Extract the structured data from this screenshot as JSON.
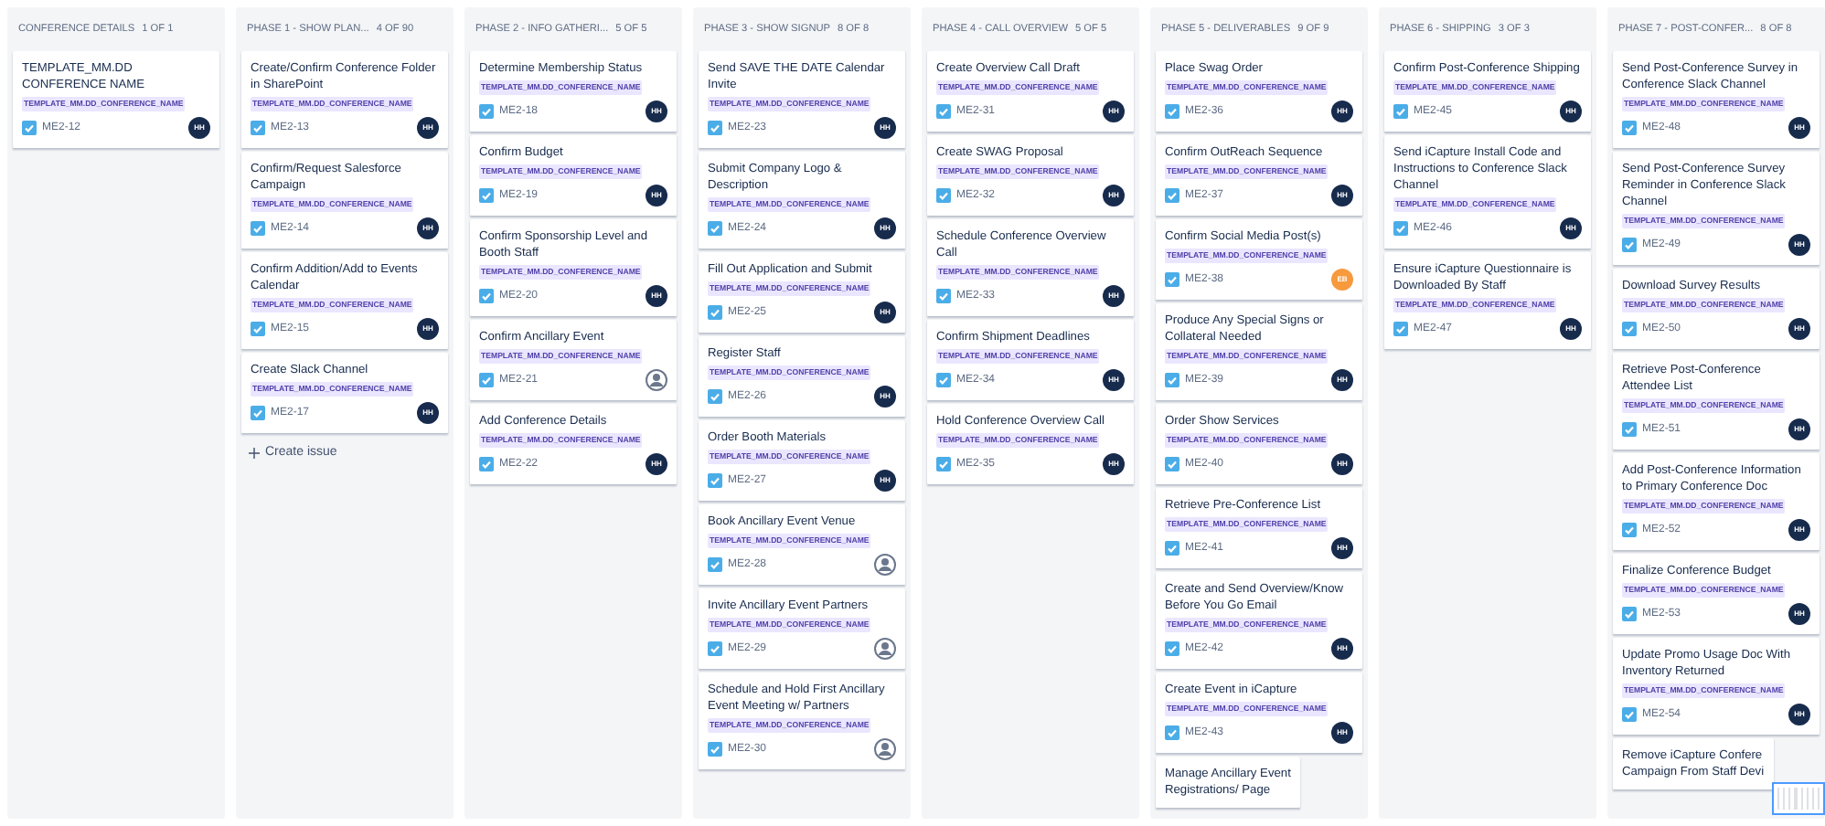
{
  "columns": [
    {
      "name": "CONFERENCE DETAILS",
      "count": "1 OF 1",
      "cards": [
        {
          "title": "TEMPLATE_MM.DD CONFERENCE NAME",
          "label": "TEMPLATE_MM.DD_CONFERENCE_NAME",
          "key": "ME2-12",
          "assignee": {
            "kind": "initials",
            "initials": "HH",
            "color": "#172b4d"
          }
        }
      ]
    },
    {
      "name": "PHASE 1 - SHOW PLAN...",
      "count": "4 OF 90",
      "create_button": "Create issue",
      "cards": [
        {
          "title": "Create/Confirm Conference Folder in SharePoint",
          "label": "TEMPLATE_MM.DD_CONFERENCE_NAME",
          "key": "ME2-13",
          "assignee": {
            "kind": "initials",
            "initials": "HH",
            "color": "#172b4d"
          }
        },
        {
          "title": "Confirm/Request Salesforce Campaign",
          "label": "TEMPLATE_MM.DD_CONFERENCE_NAME",
          "key": "ME2-14",
          "assignee": {
            "kind": "initials",
            "initials": "HH",
            "color": "#172b4d"
          }
        },
        {
          "title": "Confirm Addition/Add to Events Calendar",
          "label": "TEMPLATE_MM.DD_CONFERENCE_NAME",
          "key": "ME2-15",
          "assignee": {
            "kind": "initials",
            "initials": "HH",
            "color": "#172b4d"
          }
        },
        {
          "title": "Create Slack Channel",
          "label": "TEMPLATE_MM.DD_CONFERENCE_NAME",
          "key": "ME2-17",
          "assignee": {
            "kind": "initials",
            "initials": "HH",
            "color": "#172b4d"
          }
        }
      ]
    },
    {
      "name": "PHASE 2 - INFO GATHERI...",
      "count": "5 OF 5",
      "cards": [
        {
          "title": "Determine Membership Status",
          "label": "TEMPLATE_MM.DD_CONFERENCE_NAME",
          "key": "ME2-18",
          "assignee": {
            "kind": "initials",
            "initials": "HH",
            "color": "#172b4d"
          }
        },
        {
          "title": "Confirm Budget",
          "label": "TEMPLATE_MM.DD_CONFERENCE_NAME",
          "key": "ME2-19",
          "assignee": {
            "kind": "initials",
            "initials": "HH",
            "color": "#172b4d"
          }
        },
        {
          "title": "Confirm Sponsorship Level and Booth Staff",
          "label": "TEMPLATE_MM.DD_CONFERENCE_NAME",
          "key": "ME2-20",
          "assignee": {
            "kind": "initials",
            "initials": "HH",
            "color": "#172b4d"
          }
        },
        {
          "title": "Confirm Ancillary Event",
          "label": "TEMPLATE_MM.DD_CONFERENCE_NAME",
          "key": "ME2-21",
          "assignee": {
            "kind": "unassigned"
          }
        },
        {
          "title": "Add Conference Details",
          "label": "TEMPLATE_MM.DD_CONFERENCE_NAME",
          "key": "ME2-22",
          "assignee": {
            "kind": "initials",
            "initials": "HH",
            "color": "#172b4d"
          }
        }
      ]
    },
    {
      "name": "PHASE 3 - SHOW SIGNUP",
      "count": "8 OF 8",
      "cards": [
        {
          "title": "Send SAVE THE DATE Calendar Invite",
          "label": "TEMPLATE_MM.DD_CONFERENCE_NAME",
          "key": "ME2-23",
          "assignee": {
            "kind": "initials",
            "initials": "HH",
            "color": "#172b4d"
          }
        },
        {
          "title": "Submit Company Logo & Description",
          "label": "TEMPLATE_MM.DD_CONFERENCE_NAME",
          "key": "ME2-24",
          "assignee": {
            "kind": "initials",
            "initials": "HH",
            "color": "#172b4d"
          }
        },
        {
          "title": "Fill Out Application and Submit",
          "label": "TEMPLATE_MM.DD_CONFERENCE_NAME",
          "key": "ME2-25",
          "assignee": {
            "kind": "initials",
            "initials": "HH",
            "color": "#172b4d"
          }
        },
        {
          "title": "Register Staff",
          "label": "TEMPLATE_MM.DD_CONFERENCE_NAME",
          "key": "ME2-26",
          "assignee": {
            "kind": "initials",
            "initials": "HH",
            "color": "#172b4d"
          }
        },
        {
          "title": "Order Booth Materials",
          "label": "TEMPLATE_MM.DD_CONFERENCE_NAME",
          "key": "ME2-27",
          "assignee": {
            "kind": "initials",
            "initials": "HH",
            "color": "#172b4d"
          }
        },
        {
          "title": "Book Ancillary Event Venue",
          "label": "TEMPLATE_MM.DD_CONFERENCE_NAME",
          "key": "ME2-28",
          "assignee": {
            "kind": "unassigned"
          }
        },
        {
          "title": "Invite Ancillary Event Partners",
          "label": "TEMPLATE_MM.DD_CONFERENCE_NAME",
          "key": "ME2-29",
          "assignee": {
            "kind": "unassigned"
          }
        },
        {
          "title": "Schedule and Hold First Ancillary Event Meeting w/ Partners",
          "label": "TEMPLATE_MM.DD_CONFERENCE_NAME",
          "key": "ME2-30",
          "assignee": {
            "kind": "unassigned"
          }
        }
      ]
    },
    {
      "name": "PHASE 4 - CALL OVERVIEW",
      "count": "5 OF 5",
      "cards": [
        {
          "title": "Create Overview Call Draft",
          "label": "TEMPLATE_MM.DD_CONFERENCE_NAME",
          "key": "ME2-31",
          "assignee": {
            "kind": "initials",
            "initials": "HH",
            "color": "#172b4d"
          }
        },
        {
          "title": "Create SWAG Proposal",
          "label": "TEMPLATE_MM.DD_CONFERENCE_NAME",
          "key": "ME2-32",
          "assignee": {
            "kind": "initials",
            "initials": "HH",
            "color": "#172b4d"
          }
        },
        {
          "title": "Schedule Conference Overview Call",
          "label": "TEMPLATE_MM.DD_CONFERENCE_NAME",
          "key": "ME2-33",
          "assignee": {
            "kind": "initials",
            "initials": "HH",
            "color": "#172b4d"
          }
        },
        {
          "title": "Confirm Shipment Deadlines",
          "label": "TEMPLATE_MM.DD_CONFERENCE_NAME",
          "key": "ME2-34",
          "assignee": {
            "kind": "initials",
            "initials": "HH",
            "color": "#172b4d"
          }
        },
        {
          "title": "Hold Conference Overview Call",
          "label": "TEMPLATE_MM.DD_CONFERENCE_NAME",
          "key": "ME2-35",
          "assignee": {
            "kind": "initials",
            "initials": "HH",
            "color": "#172b4d"
          }
        }
      ]
    },
    {
      "name": "PHASE 5 - DELIVERABLES",
      "count": "9 OF 9",
      "cards": [
        {
          "title": "Place Swag Order",
          "label": "TEMPLATE_MM.DD_CONFERENCE_NAME",
          "key": "ME2-36",
          "assignee": {
            "kind": "initials",
            "initials": "HH",
            "color": "#172b4d"
          }
        },
        {
          "title": "Confirm OutReach Sequence",
          "label": "TEMPLATE_MM.DD_CONFERENCE_NAME",
          "key": "ME2-37",
          "assignee": {
            "kind": "initials",
            "initials": "HH",
            "color": "#172b4d"
          }
        },
        {
          "title": "Confirm Social Media Post(s)",
          "label": "TEMPLATE_MM.DD_CONFERENCE_NAME",
          "key": "ME2-38",
          "assignee": {
            "kind": "initials",
            "initials": "EB",
            "color": "#f79a3e"
          }
        },
        {
          "title": "Produce Any Special Signs or Collateral Needed",
          "label": "TEMPLATE_MM.DD_CONFERENCE_NAME",
          "key": "ME2-39",
          "assignee": {
            "kind": "initials",
            "initials": "HH",
            "color": "#172b4d"
          }
        },
        {
          "title": "Order Show Services",
          "label": "TEMPLATE_MM.DD_CONFERENCE_NAME",
          "key": "ME2-40",
          "assignee": {
            "kind": "initials",
            "initials": "HH",
            "color": "#172b4d"
          }
        },
        {
          "title": "Retrieve Pre-Conference List",
          "label": "TEMPLATE_MM.DD_CONFERENCE_NAME",
          "key": "ME2-41",
          "assignee": {
            "kind": "initials",
            "initials": "HH",
            "color": "#172b4d"
          }
        },
        {
          "title": "Create and Send Overview/Know Before You Go Email",
          "label": "TEMPLATE_MM.DD_CONFERENCE_NAME",
          "key": "ME2-42",
          "assignee": {
            "kind": "initials",
            "initials": "HH",
            "color": "#172b4d"
          }
        },
        {
          "title": "Create Event in iCapture",
          "label": "TEMPLATE_MM.DD_CONFERENCE_NAME",
          "key": "ME2-43",
          "assignee": {
            "kind": "initials",
            "initials": "HH",
            "color": "#172b4d"
          }
        },
        {
          "title": "Manage Ancillary Event\nRegistrations/ Page"
        }
      ]
    },
    {
      "name": "PHASE 6 - SHIPPING",
      "count": "3 OF 3",
      "cards": [
        {
          "title": "Confirm Post-Conference Shipping",
          "label": "TEMPLATE_MM.DD_CONFERENCE_NAME",
          "key": "ME2-45",
          "assignee": {
            "kind": "initials",
            "initials": "HH",
            "color": "#172b4d"
          }
        },
        {
          "title": "Send iCapture Install Code and Instructions to Conference Slack Channel",
          "label": "TEMPLATE_MM.DD_CONFERENCE_NAME",
          "key": "ME2-46",
          "assignee": {
            "kind": "initials",
            "initials": "HH",
            "color": "#172b4d"
          }
        },
        {
          "title": "Ensure iCapture Questionnaire is Downloaded By Staff",
          "label": "TEMPLATE_MM.DD_CONFERENCE_NAME",
          "key": "ME2-47",
          "assignee": {
            "kind": "initials",
            "initials": "HH",
            "color": "#172b4d"
          }
        }
      ]
    },
    {
      "name": "PHASE 7 - POST-CONFER...",
      "count": "8 OF 8",
      "cards": [
        {
          "title": "Send Post-Conference Survey in Conference Slack Channel",
          "label": "TEMPLATE_MM.DD_CONFERENCE_NAME",
          "key": "ME2-48",
          "assignee": {
            "kind": "initials",
            "initials": "HH",
            "color": "#172b4d"
          }
        },
        {
          "title": "Send Post-Conference Survey Reminder in Conference Slack Channel",
          "label": "TEMPLATE_MM.DD_CONFERENCE_NAME",
          "key": "ME2-49",
          "assignee": {
            "kind": "initials",
            "initials": "HH",
            "color": "#172b4d"
          }
        },
        {
          "title": "Download Survey Results",
          "label": "TEMPLATE_MM.DD_CONFERENCE_NAME",
          "key": "ME2-50",
          "assignee": {
            "kind": "initials",
            "initials": "HH",
            "color": "#172b4d"
          }
        },
        {
          "title": "Retrieve Post-Conference Attendee List",
          "label": "TEMPLATE_MM.DD_CONFERENCE_NAME",
          "key": "ME2-51",
          "assignee": {
            "kind": "initials",
            "initials": "HH",
            "color": "#172b4d"
          }
        },
        {
          "title": "Add Post-Conference Information to Primary Conference Doc",
          "label": "TEMPLATE_MM.DD_CONFERENCE_NAME",
          "key": "ME2-52",
          "assignee": {
            "kind": "initials",
            "initials": "HH",
            "color": "#172b4d"
          }
        },
        {
          "title": "Finalize Conference Budget",
          "label": "TEMPLATE_MM.DD_CONFERENCE_NAME",
          "key": "ME2-53",
          "assignee": {
            "kind": "initials",
            "initials": "HH",
            "color": "#172b4d"
          }
        },
        {
          "title": "Update Promo Usage Doc With Inventory Returned",
          "label": "TEMPLATE_MM.DD_CONFERENCE_NAME",
          "key": "ME2-54",
          "assignee": {
            "kind": "initials",
            "initials": "HH",
            "color": "#172b4d"
          }
        },
        {
          "title": "Remove iCapture Confere\nCampaign From Staff Devi"
        }
      ]
    }
  ]
}
